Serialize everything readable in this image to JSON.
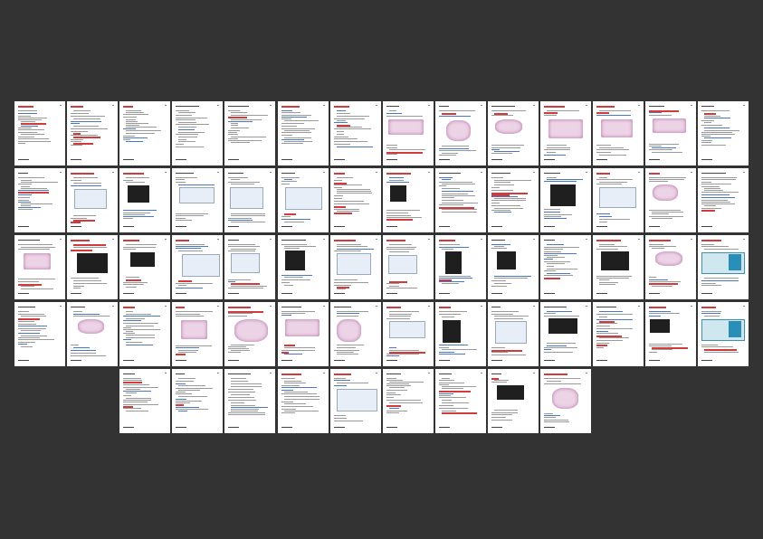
{
  "viewer": {
    "background": "#333333"
  },
  "pages": [
    {
      "n": 1,
      "t": "text"
    },
    {
      "n": 2,
      "t": "text"
    },
    {
      "n": 3,
      "t": "text"
    },
    {
      "n": 4,
      "t": "text"
    },
    {
      "n": 5,
      "t": "text"
    },
    {
      "n": 6,
      "t": "text"
    },
    {
      "n": 7,
      "t": "text"
    },
    {
      "n": 8,
      "t": "pink"
    },
    {
      "n": 9,
      "t": "pink"
    },
    {
      "n": 10,
      "t": "pink"
    },
    {
      "n": 11,
      "t": "pink"
    },
    {
      "n": 12,
      "t": "pink"
    },
    {
      "n": 13,
      "t": "pink"
    },
    {
      "n": 14,
      "t": "text"
    },
    {
      "n": 15,
      "t": "text"
    },
    {
      "n": 16,
      "t": "ui"
    },
    {
      "n": 17,
      "t": "dark"
    },
    {
      "n": 18,
      "t": "ui"
    },
    {
      "n": 19,
      "t": "ui"
    },
    {
      "n": 20,
      "t": "ui"
    },
    {
      "n": 21,
      "t": "text"
    },
    {
      "n": 22,
      "t": "dark"
    },
    {
      "n": 23,
      "t": "text"
    },
    {
      "n": 24,
      "t": "text"
    },
    {
      "n": 25,
      "t": "dark"
    },
    {
      "n": 26,
      "t": "ui"
    },
    {
      "n": 27,
      "t": "pink"
    },
    {
      "n": 28,
      "t": "text"
    },
    {
      "n": 29,
      "t": "pink"
    },
    {
      "n": 30,
      "t": "dark"
    },
    {
      "n": 31,
      "t": "dark"
    },
    {
      "n": 32,
      "t": "ui"
    },
    {
      "n": 33,
      "t": "ui"
    },
    {
      "n": 34,
      "t": "dark"
    },
    {
      "n": 35,
      "t": "ui"
    },
    {
      "n": 36,
      "t": "ui"
    },
    {
      "n": 37,
      "t": "dark"
    },
    {
      "n": 38,
      "t": "dark"
    },
    {
      "n": 39,
      "t": "text"
    },
    {
      "n": 40,
      "t": "dark"
    },
    {
      "n": 41,
      "t": "pink"
    },
    {
      "n": 42,
      "t": "teal"
    },
    {
      "n": 43,
      "t": "text"
    },
    {
      "n": 44,
      "t": "pink"
    },
    {
      "n": 45,
      "t": "text"
    },
    {
      "n": 46,
      "t": "pink"
    },
    {
      "n": 47,
      "t": "pink"
    },
    {
      "n": 48,
      "t": "pink"
    },
    {
      "n": 49,
      "t": "pink"
    },
    {
      "n": 50,
      "t": "ui"
    },
    {
      "n": 51,
      "t": "dark"
    },
    {
      "n": 52,
      "t": "ui"
    },
    {
      "n": 53,
      "t": "dark"
    },
    {
      "n": 54,
      "t": "text"
    },
    {
      "n": 55,
      "t": "dark"
    },
    {
      "n": 56,
      "t": "teal"
    },
    {
      "n": 57,
      "t": "text"
    },
    {
      "n": 58,
      "t": "text"
    },
    {
      "n": 59,
      "t": "text"
    },
    {
      "n": 60,
      "t": "text"
    },
    {
      "n": 61,
      "t": "ui"
    },
    {
      "n": 62,
      "t": "text"
    },
    {
      "n": 63,
      "t": "text"
    },
    {
      "n": 64,
      "t": "dark"
    },
    {
      "n": 65,
      "t": "pink"
    }
  ]
}
